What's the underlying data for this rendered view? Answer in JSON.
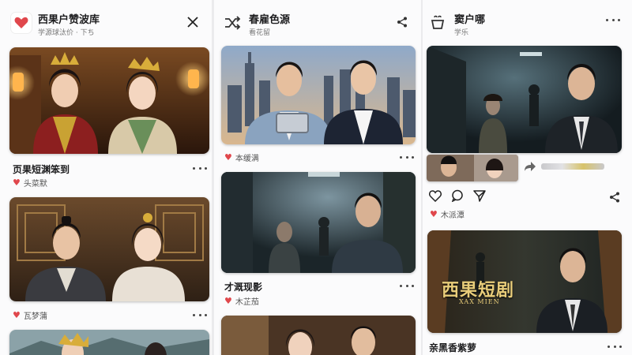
{
  "col1": {
    "title": "西果户赞波库",
    "subtitle": "学源球汰价 · 下ち",
    "items": [
      {
        "title": "页果短渊笨到",
        "meta": "头菜默"
      },
      {
        "title": "",
        "meta": "瓦梦蒲"
      }
    ]
  },
  "col2": {
    "title": "春雇色源",
    "subtitle": "看花留",
    "items": [
      {
        "title": "",
        "meta": "本缓满"
      },
      {
        "title": "才溉现影",
        "meta": "木芷茄"
      }
    ]
  },
  "col3": {
    "title": "窦户哪",
    "subtitle": "学乐",
    "items": [
      {
        "title": "",
        "meta": "木派潭"
      },
      {
        "title": "亲黑香紫萝",
        "meta": ""
      }
    ],
    "poster_title": "西果短剧",
    "poster_sub": "XAX MIEN"
  },
  "colors": {
    "accent": "#e0474c",
    "card_bg": "#fbfbfc",
    "page_bg": "#ebebed"
  },
  "icons": [
    "heart-icon",
    "close-icon",
    "shuffle-icon",
    "share-icon",
    "teacup-icon",
    "more-icon",
    "comment-icon",
    "send-icon",
    "forward-icon"
  ]
}
